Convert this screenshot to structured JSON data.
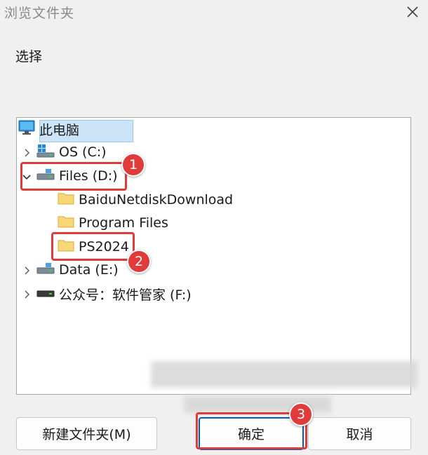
{
  "dialog": {
    "title": "浏览文件夹",
    "prompt": "选择"
  },
  "tree": {
    "root": {
      "label": "此电脑",
      "icon": "computer-icon"
    },
    "drives": [
      {
        "label": "OS (C:)",
        "icon": "windows-drive-icon",
        "expanded": false
      },
      {
        "label": "Files (D:)",
        "icon": "drive-icon",
        "expanded": true,
        "children": [
          {
            "label": "BaiduNetdiskDownload",
            "icon": "folder-icon"
          },
          {
            "label": "Program Files",
            "icon": "folder-icon"
          },
          {
            "label": "PS2024",
            "icon": "folder-icon",
            "selected": true
          }
        ]
      },
      {
        "label": "Data (E:)",
        "icon": "drive-icon",
        "expanded": false
      },
      {
        "label": "公众号：软件管家 (F:)",
        "icon": "drive-icon",
        "expanded": false
      }
    ]
  },
  "buttons": {
    "new_folder": "新建文件夹(M)",
    "ok": "确定",
    "cancel": "取消"
  },
  "annotations": {
    "badge1": "1",
    "badge2": "2",
    "badge3": "3"
  },
  "colors": {
    "annotation_red": "#e03a3a",
    "selection_bg": "#cce4f7",
    "folder_yellow": "#f8d775"
  }
}
